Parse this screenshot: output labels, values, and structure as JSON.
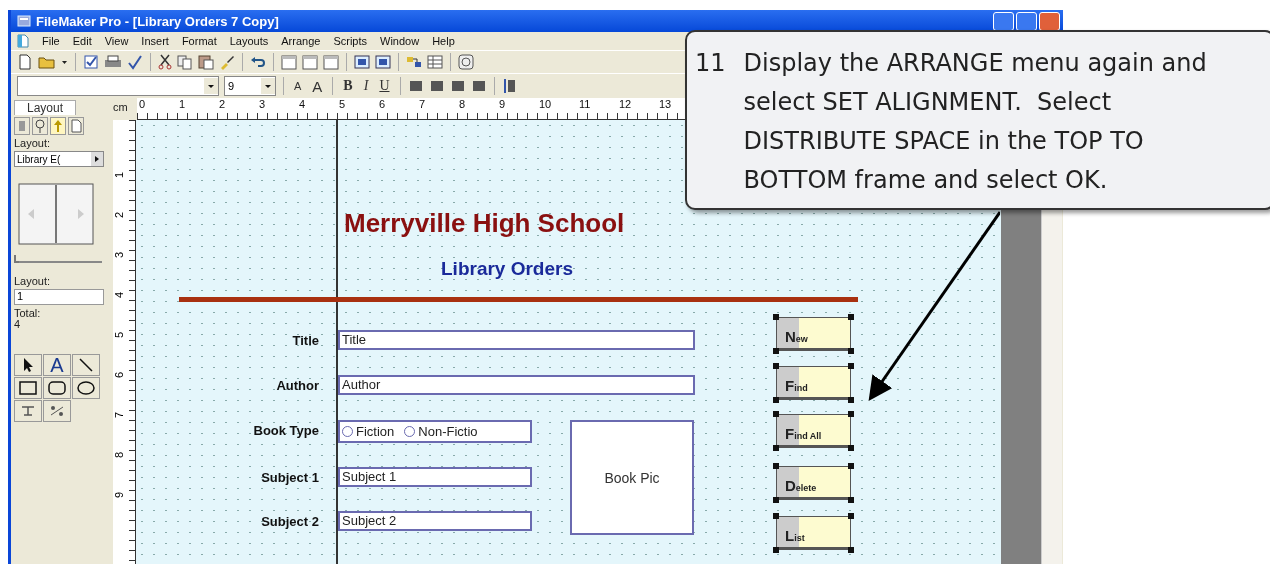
{
  "window": {
    "title": "FileMaker Pro - [Library Orders 7 Copy]"
  },
  "menu": [
    "File",
    "Edit",
    "View",
    "Insert",
    "Format",
    "Layouts",
    "Arrange",
    "Scripts",
    "Window",
    "Help"
  ],
  "format_bar": {
    "font_size": "9",
    "size_buttons": [
      {
        "label": "A",
        "kind": "smaller"
      },
      {
        "label": "A",
        "kind": "larger"
      }
    ],
    "styles": [
      {
        "label": "B",
        "kind": "bold"
      },
      {
        "label": "I",
        "kind": "italic"
      },
      {
        "label": "U",
        "kind": "underline"
      }
    ]
  },
  "sidebar": {
    "tab": "Layout",
    "layout_label": "Layout:",
    "layout_menu": "Library E(",
    "slider": {
      "level": 0
    },
    "page_label": "Layout:",
    "page": "1",
    "total_label": "Total:",
    "total": "4",
    "text_tool": "A"
  },
  "rulers": {
    "unit": "cm",
    "horizontal": [
      "0",
      "1",
      "2",
      "3",
      "4",
      "5",
      "6",
      "7",
      "8",
      "9",
      "10",
      "11",
      "12",
      "13"
    ],
    "vertical": [
      "1",
      "2",
      "3",
      "4",
      "5",
      "6",
      "7",
      "8",
      "9"
    ]
  },
  "layout": {
    "heading": "Merryville High School",
    "subheading": "Library Orders",
    "fields": [
      {
        "label": "Title",
        "kind": "text",
        "value": "Title"
      },
      {
        "label": "Author",
        "kind": "text",
        "value": "Author"
      },
      {
        "label": "Book Type",
        "kind": "radio",
        "options": [
          {
            "text": "Fiction",
            "selected": false
          },
          {
            "text": "Non-Fictio",
            "selected": false
          }
        ]
      },
      {
        "label": "Subject 1",
        "kind": "text",
        "value": "Subject 1"
      },
      {
        "label": "Subject 2",
        "kind": "text",
        "value": "Subject 2"
      }
    ],
    "picture_field": "Book Pic",
    "buttons": [
      {
        "label": "New",
        "selected": true
      },
      {
        "label": "Find",
        "selected": true
      },
      {
        "label": "Find All",
        "selected": true
      },
      {
        "label": "Delete",
        "selected": true
      },
      {
        "label": "List",
        "selected": true
      }
    ]
  },
  "callout": {
    "number": "11",
    "text": "Display the ARRANGE menu again and select SET ALIGNMENT.  Select DISTRIBUTE SPACE in the TOP TO BOTTOM frame and select OK."
  }
}
